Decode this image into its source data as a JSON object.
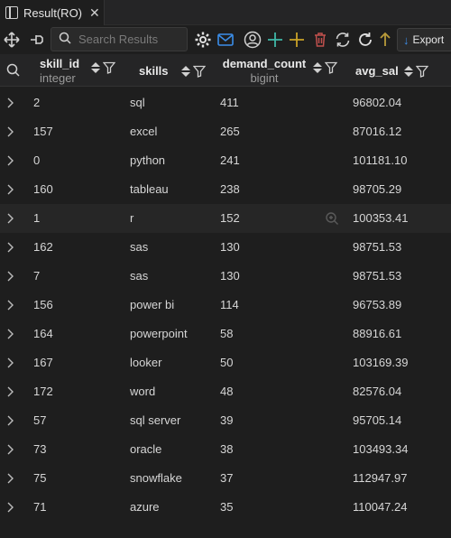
{
  "tab": {
    "label": "Result(RO)",
    "close": "✕"
  },
  "toolbar": {
    "search_placeholder": "Search Results",
    "export_label": "Export"
  },
  "columns": [
    {
      "name": "skill_id",
      "type": "integer"
    },
    {
      "name": "skills",
      "type": ""
    },
    {
      "name": "demand_count",
      "type": "bigint"
    },
    {
      "name": "avg_sal",
      "type": ""
    }
  ],
  "rows": [
    {
      "skill_id": "2",
      "skills": "sql",
      "demand_count": "411",
      "avg_sal": "96802.04"
    },
    {
      "skill_id": "157",
      "skills": "excel",
      "demand_count": "265",
      "avg_sal": "87016.12"
    },
    {
      "skill_id": "0",
      "skills": "python",
      "demand_count": "241",
      "avg_sal": "101181.10"
    },
    {
      "skill_id": "160",
      "skills": "tableau",
      "demand_count": "238",
      "avg_sal": "98705.29"
    },
    {
      "skill_id": "1",
      "skills": "r",
      "demand_count": "152",
      "avg_sal": "100353.41"
    },
    {
      "skill_id": "162",
      "skills": "sas",
      "demand_count": "130",
      "avg_sal": "98751.53"
    },
    {
      "skill_id": "7",
      "skills": "sas",
      "demand_count": "130",
      "avg_sal": "98751.53"
    },
    {
      "skill_id": "156",
      "skills": "power bi",
      "demand_count": "114",
      "avg_sal": "96753.89"
    },
    {
      "skill_id": "164",
      "skills": "powerpoint",
      "demand_count": "58",
      "avg_sal": "88916.61"
    },
    {
      "skill_id": "167",
      "skills": "looker",
      "demand_count": "50",
      "avg_sal": "103169.39"
    },
    {
      "skill_id": "172",
      "skills": "word",
      "demand_count": "48",
      "avg_sal": "82576.04"
    },
    {
      "skill_id": "57",
      "skills": "sql server",
      "demand_count": "39",
      "avg_sal": "95705.14"
    },
    {
      "skill_id": "73",
      "skills": "oracle",
      "demand_count": "38",
      "avg_sal": "103493.34"
    },
    {
      "skill_id": "75",
      "skills": "snowflake",
      "demand_count": "37",
      "avg_sal": "112947.97"
    },
    {
      "skill_id": "71",
      "skills": "azure",
      "demand_count": "35",
      "avg_sal": "110047.24"
    }
  ],
  "selected_row_index": 4,
  "colors": {
    "background": "#1e1e1e",
    "accent_blue": "#3b8eea",
    "add_green": "#3fb8a8",
    "add_yellow": "#c9a227",
    "delete_red": "#c0504d"
  }
}
